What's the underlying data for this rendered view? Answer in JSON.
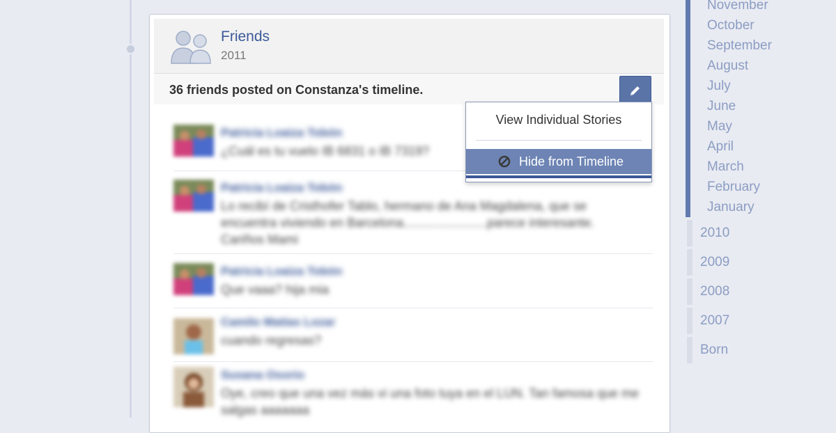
{
  "card": {
    "title": "Friends",
    "year": "2011",
    "summary": "36 friends posted on Constanza's timeline."
  },
  "menu": {
    "view_stories": "View Individual Stories",
    "hide_from_timeline": "Hide from Timeline"
  },
  "stories": [
    {
      "name": "Patricia Loaiza Tobón",
      "text": "¿Cuál es tu vuelo IB 6831 o IB 7319?"
    },
    {
      "name": "Patricia Loaiza Tobón",
      "text": "Lo recibí de Cristhofer Tablo, hermano de Ana Magdalena, que se encuentra viviendo en Barcelona........................parece interesante. Cariños Mami"
    },
    {
      "name": "Patricia Loaiza Tobón",
      "text": "Que vaaa? hija mia"
    },
    {
      "name": "Camilo Matías Lozar",
      "text": "cuando regresas?"
    },
    {
      "name": "Susana Osorio",
      "text": "Oye, creo que una vez más vi una foto tuya en el LUN. Tan famosa que me salgas aaaaaaa"
    }
  ],
  "timeline_nav": {
    "months": [
      "November",
      "October",
      "September",
      "August",
      "July",
      "June",
      "May",
      "April",
      "March",
      "February",
      "January"
    ],
    "years": [
      "2010",
      "2009",
      "2008",
      "2007",
      "Born"
    ]
  }
}
